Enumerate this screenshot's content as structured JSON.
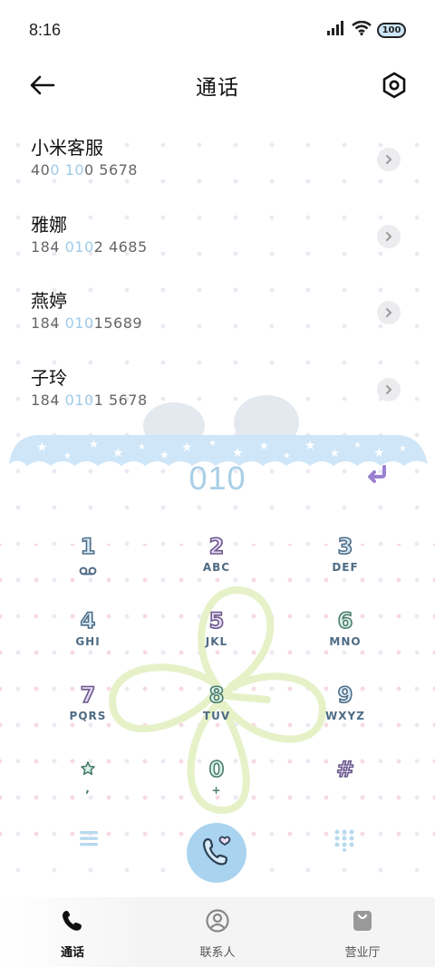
{
  "status_bar": {
    "time": "8:16",
    "battery": "100"
  },
  "header": {
    "title": "通话"
  },
  "contacts": [
    {
      "name": "小米客服",
      "number_parts": [
        "40",
        "0",
        " ",
        "10",
        "0 5678"
      ]
    },
    {
      "name": "雅娜",
      "number_parts": [
        "184 ",
        "010",
        "",
        "",
        "2 4685"
      ]
    },
    {
      "name": "燕婷",
      "number_parts": [
        "184 ",
        "010",
        "",
        "",
        "15689"
      ]
    },
    {
      "name": "子玲",
      "number_parts": [
        "184 ",
        "010",
        "",
        "",
        "1 5678"
      ]
    }
  ],
  "dial_input": "010",
  "keypad": [
    {
      "digit": "1",
      "letters": "",
      "sub_icon": "voicemail-icon"
    },
    {
      "digit": "2",
      "letters": "ABC"
    },
    {
      "digit": "3",
      "letters": "DEF"
    },
    {
      "digit": "4",
      "letters": "GHI"
    },
    {
      "digit": "5",
      "letters": "JKL"
    },
    {
      "digit": "6",
      "letters": "MNO"
    },
    {
      "digit": "7",
      "letters": "PQRS"
    },
    {
      "digit": "8",
      "letters": "TUV"
    },
    {
      "digit": "9",
      "letters": "WXYZ"
    },
    {
      "digit": "",
      "letters": ",",
      "sub_icon": "star-flower-icon"
    },
    {
      "digit": "0",
      "letters": "+"
    },
    {
      "digit": "#",
      "letters": ""
    }
  ],
  "tabs": [
    {
      "label": "通话",
      "icon": "phone-icon",
      "active": true
    },
    {
      "label": "联系人",
      "icon": "contact-icon",
      "active": false
    },
    {
      "label": "营业厅",
      "icon": "shopping-bag-icon",
      "active": false
    }
  ],
  "colors": {
    "accent_blue": "#a9d3ef",
    "highlight_number": "#9fcbe9",
    "clover": "#e8f3c9",
    "cloud": "#cfe6f8"
  }
}
